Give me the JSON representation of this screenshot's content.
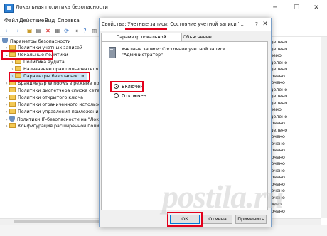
{
  "main": {
    "title": "Локальная политика безопасности",
    "menu": [
      "Файл",
      "Действие",
      "Вид",
      "Справка"
    ],
    "tree": [
      {
        "label": "Параметры безопасности",
        "exp": "",
        "icon": "shield"
      },
      {
        "label": "Политики учетных записей",
        "exp": "›",
        "icon": "folder"
      },
      {
        "label": "Локальные политики",
        "exp": "⌄",
        "icon": "folder"
      },
      {
        "label": "Политика аудита",
        "exp": "›",
        "icon": "folder"
      },
      {
        "label": "Назначение прав пользователя",
        "exp": "›",
        "icon": "folder"
      },
      {
        "label": "Параметры безопасности",
        "exp": "›",
        "icon": "folder"
      },
      {
        "label": "Брандмауэр Windows в режиме повышенной безопасности",
        "exp": "›",
        "icon": "folder"
      },
      {
        "label": "Политики диспетчера списка сетей",
        "exp": "",
        "icon": "folder"
      },
      {
        "label": "Политики открытого ключа",
        "exp": "›",
        "icon": "folder"
      },
      {
        "label": "Политики ограниченного использования программ",
        "exp": "›",
        "icon": "folder"
      },
      {
        "label": "Политики управления приложениями",
        "exp": "›",
        "icon": "folder"
      },
      {
        "label": "Политики IP-безопасности на \"Локальный компьютер\"",
        "exp": "›",
        "icon": "shield"
      },
      {
        "label": "Конфигурация расширенной политики аудита",
        "exp": "›",
        "icon": "folder"
      }
    ],
    "right_column": [
      "делено",
      "делено",
      "лено",
      "делено",
      "делено",
      "ючено",
      "ючено",
      "делено",
      "делено",
      "делено",
      "лено",
      "делено",
      "ючено",
      "делено",
      "ючено",
      "ючено",
      "ючено",
      "ючено",
      "ючено",
      "ючено",
      "ючено",
      "ючено",
      "ючено",
      "ючено",
      "лено",
      "ючено"
    ]
  },
  "dialog": {
    "title": "Свойства: Учетные записи: Состояние учетной записи '...",
    "help": "?",
    "close": "✕",
    "tabs": [
      "Параметр локальной безопасности",
      "Объяснение"
    ],
    "description": "Учетные записи: Состояние учетной записи \"Администратор\"",
    "options": [
      "Включен",
      "Отключен"
    ],
    "selected": "Включен",
    "buttons": {
      "ok": "ОК",
      "cancel": "Отмена",
      "apply": "Применить"
    }
  },
  "colors": {
    "highlight_red": "#e3001b",
    "selection": "#cce4f7",
    "dialog_bg": "#f0f0f0"
  },
  "watermark": "postila.ru"
}
